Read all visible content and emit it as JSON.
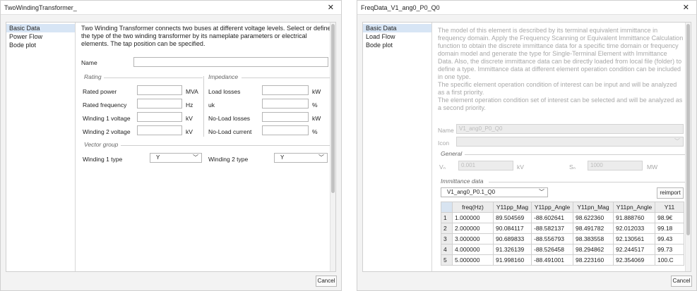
{
  "left_dialog": {
    "title": "TwoWindingTransformer_",
    "nav": [
      "Basic Data",
      "Power Flow",
      "Bode plot"
    ],
    "description": "Two Winding Transformer connects two buses at different voltage levels. Select or define the type of the two winding transformer by its nameplate parameters or electrical elements. The tap position can be specified.",
    "name_label": "Name",
    "name_value": "",
    "rating": {
      "title": "Rating",
      "fields": [
        {
          "label": "Rated power",
          "unit": "MVA",
          "value": ""
        },
        {
          "label": "Rated frequency",
          "unit": "Hz",
          "value": ""
        },
        {
          "label": "Winding 1 voltage",
          "unit": "kV",
          "value": ""
        },
        {
          "label": "Winding 2 voltage",
          "unit": "kV",
          "value": ""
        }
      ]
    },
    "impedance": {
      "title": "Impedance",
      "fields": [
        {
          "label": "Load losses",
          "unit": "kW",
          "value": ""
        },
        {
          "label": "uk",
          "unit": "%",
          "value": ""
        },
        {
          "label": "No-Load losses",
          "unit": "kW",
          "value": ""
        },
        {
          "label": "No-Load current",
          "unit": "%",
          "value": ""
        }
      ]
    },
    "vector_group": {
      "title": "Vector group",
      "w1_label": "Winding 1 type",
      "w1_value": "Y",
      "w2_label": "Winding 2 type",
      "w2_value": "Y"
    },
    "cancel": "Cancel"
  },
  "right_dialog": {
    "title": "FreqData_V1_ang0_P0_Q0",
    "nav": [
      "Basic Data",
      "Load Flow",
      "Bode plot"
    ],
    "description": [
      "The model of this element is described by its terminal equivalent immittance in",
      "frequency domain. Apply the Frequency Scanning or Equivalent Immittance Calculation",
      "function to obtain the discrete immittance data for a specific time domain or frequency",
      "domain model and generate the type for Single-Terminal Element with Immittance",
      "Data. Also, the discrete immittance data can be directly loaded from local file (folder) to",
      "define a type. Immittance data at different element operation condition can be included",
      "in one type.",
      "The specific element operation condition of interest can be input and will be analyzed",
      "as a first priority.",
      "The element operation condition set of interest can be selected and will be analyzed as",
      "a second priority."
    ],
    "name_label": "Name",
    "name_value": "V1_ang0_P0_Q0",
    "icon_label": "Icon",
    "general": {
      "title": "General",
      "vn_label": "Vₙ",
      "vn_value": "0.001",
      "vn_unit": "kV",
      "sn_label": "Sₙ",
      "sn_value": "1000",
      "sn_unit": "MW"
    },
    "immittance": {
      "title": "Immittance data",
      "selected": "V1_ang0_P0.1_Q0",
      "reimport": "reimport",
      "columns": [
        "freq(Hz)",
        "Y11pp_Mag",
        "Y11pp_Angle",
        "Y11pn_Mag",
        "Y11pn_Angle",
        "Y11"
      ],
      "rows": [
        [
          "1",
          "1.000000",
          "89.504569",
          "-88.602641",
          "98.622360",
          "91.888760",
          "98.9€"
        ],
        [
          "2",
          "2.000000",
          "90.084117",
          "-88.582137",
          "98.491782",
          "92.012033",
          "99.18"
        ],
        [
          "3",
          "3.000000",
          "90.689833",
          "-88.556793",
          "98.383558",
          "92.130561",
          "99.43"
        ],
        [
          "4",
          "4.000000",
          "91.326139",
          "-88.526458",
          "98.294862",
          "92.244517",
          "99.73"
        ],
        [
          "5",
          "5.000000",
          "91.998160",
          "-88.491001",
          "98.223160",
          "92.354069",
          "100.C"
        ]
      ]
    },
    "cancel": "Cancel"
  }
}
